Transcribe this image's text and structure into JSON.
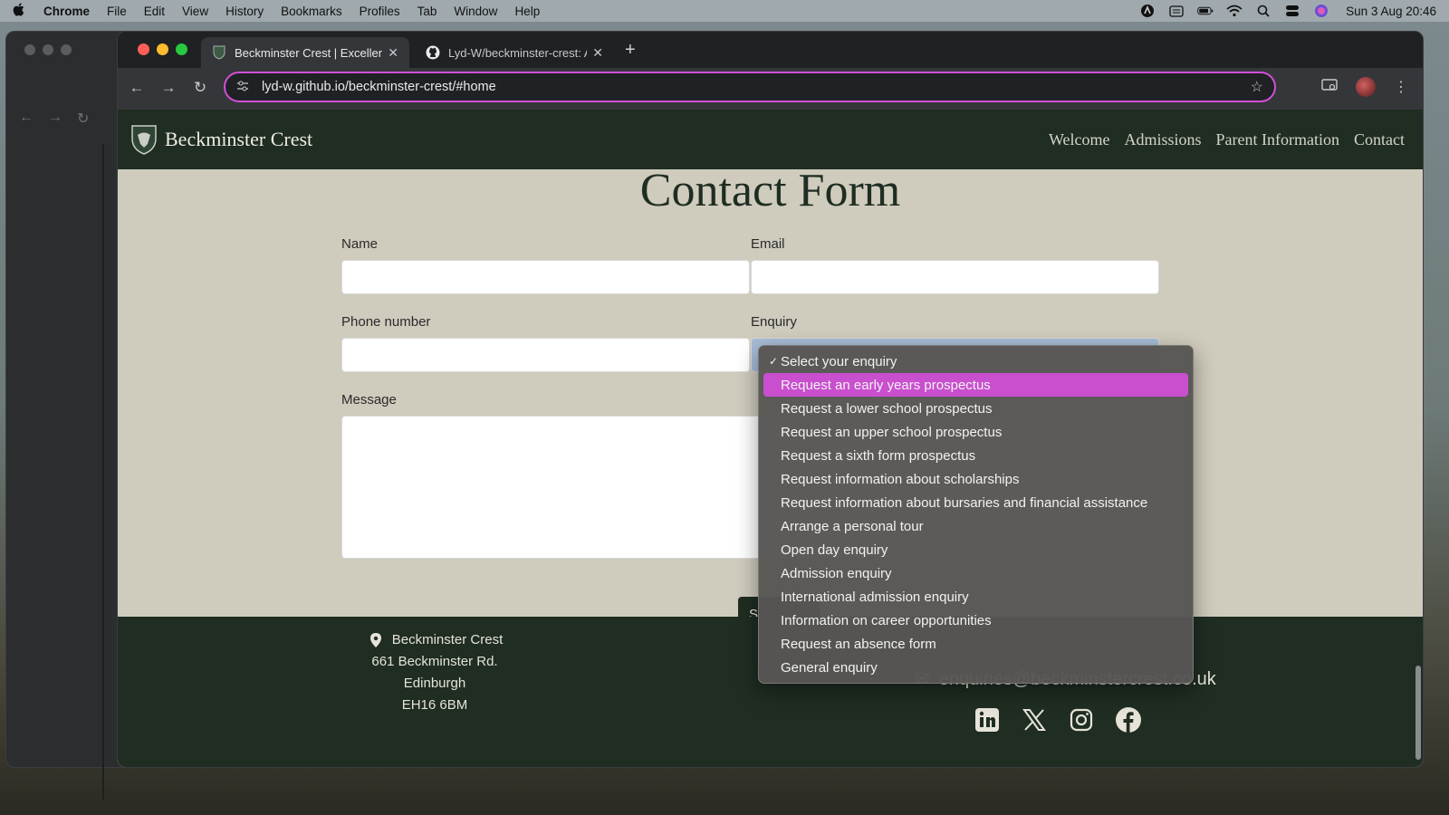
{
  "menubar": {
    "app": "Chrome",
    "items": [
      "File",
      "Edit",
      "View",
      "History",
      "Bookmarks",
      "Profiles",
      "Tab",
      "Window",
      "Help"
    ],
    "clock": "Sun 3 Aug  20:46",
    "status_icons": [
      "vpn-icon",
      "keyboard-icon",
      "battery-icon",
      "wifi-icon",
      "spotlight-icon",
      "control-center-icon",
      "siri-icon"
    ]
  },
  "browser": {
    "tabs": [
      {
        "title": "Beckminster Crest | Excellence",
        "icon": "crest-favicon",
        "active": true
      },
      {
        "title": "Lyd-W/beckminster-crest: A w",
        "icon": "github-icon",
        "active": false
      }
    ],
    "url": "lyd-w.github.io/beckminster-crest/#home"
  },
  "site": {
    "brand": "Beckminster Crest",
    "nav": [
      "Welcome",
      "Admissions",
      "Parent Information",
      "Contact"
    ]
  },
  "form": {
    "title": "Contact Form",
    "name_label": "Name",
    "email_label": "Email",
    "phone_label": "Phone number",
    "enquiry_label": "Enquiry",
    "message_label": "Message",
    "submit_label": "S"
  },
  "dropdown": {
    "selected": "Select your enquiry",
    "highlighted_index": 1,
    "options": [
      "Select your enquiry",
      "Request an early years prospectus",
      "Request a lower school prospectus",
      "Request an upper school prospectus",
      "Request a sixth form prospectus",
      "Request information about scholarships",
      "Request information about bursaries and financial assistance",
      "Arrange a personal tour",
      "Open day enquiry",
      "Admission enquiry",
      "International admission enquiry",
      "Information on career opportunities",
      "Request an absence form",
      "General enquiry"
    ]
  },
  "footer": {
    "address": [
      "Beckminster Crest",
      "661 Beckminster Rd.",
      "Edinburgh",
      "EH16 6BM"
    ],
    "email": "enquiries@beckminstercrest.co.uk",
    "socials": [
      "linkedin-icon",
      "x-icon",
      "instagram-icon",
      "facebook-icon"
    ]
  },
  "colors": {
    "brand_green": "#1f2d22",
    "page_bg": "#cfcbbd",
    "highlight": "#c94fcf"
  }
}
